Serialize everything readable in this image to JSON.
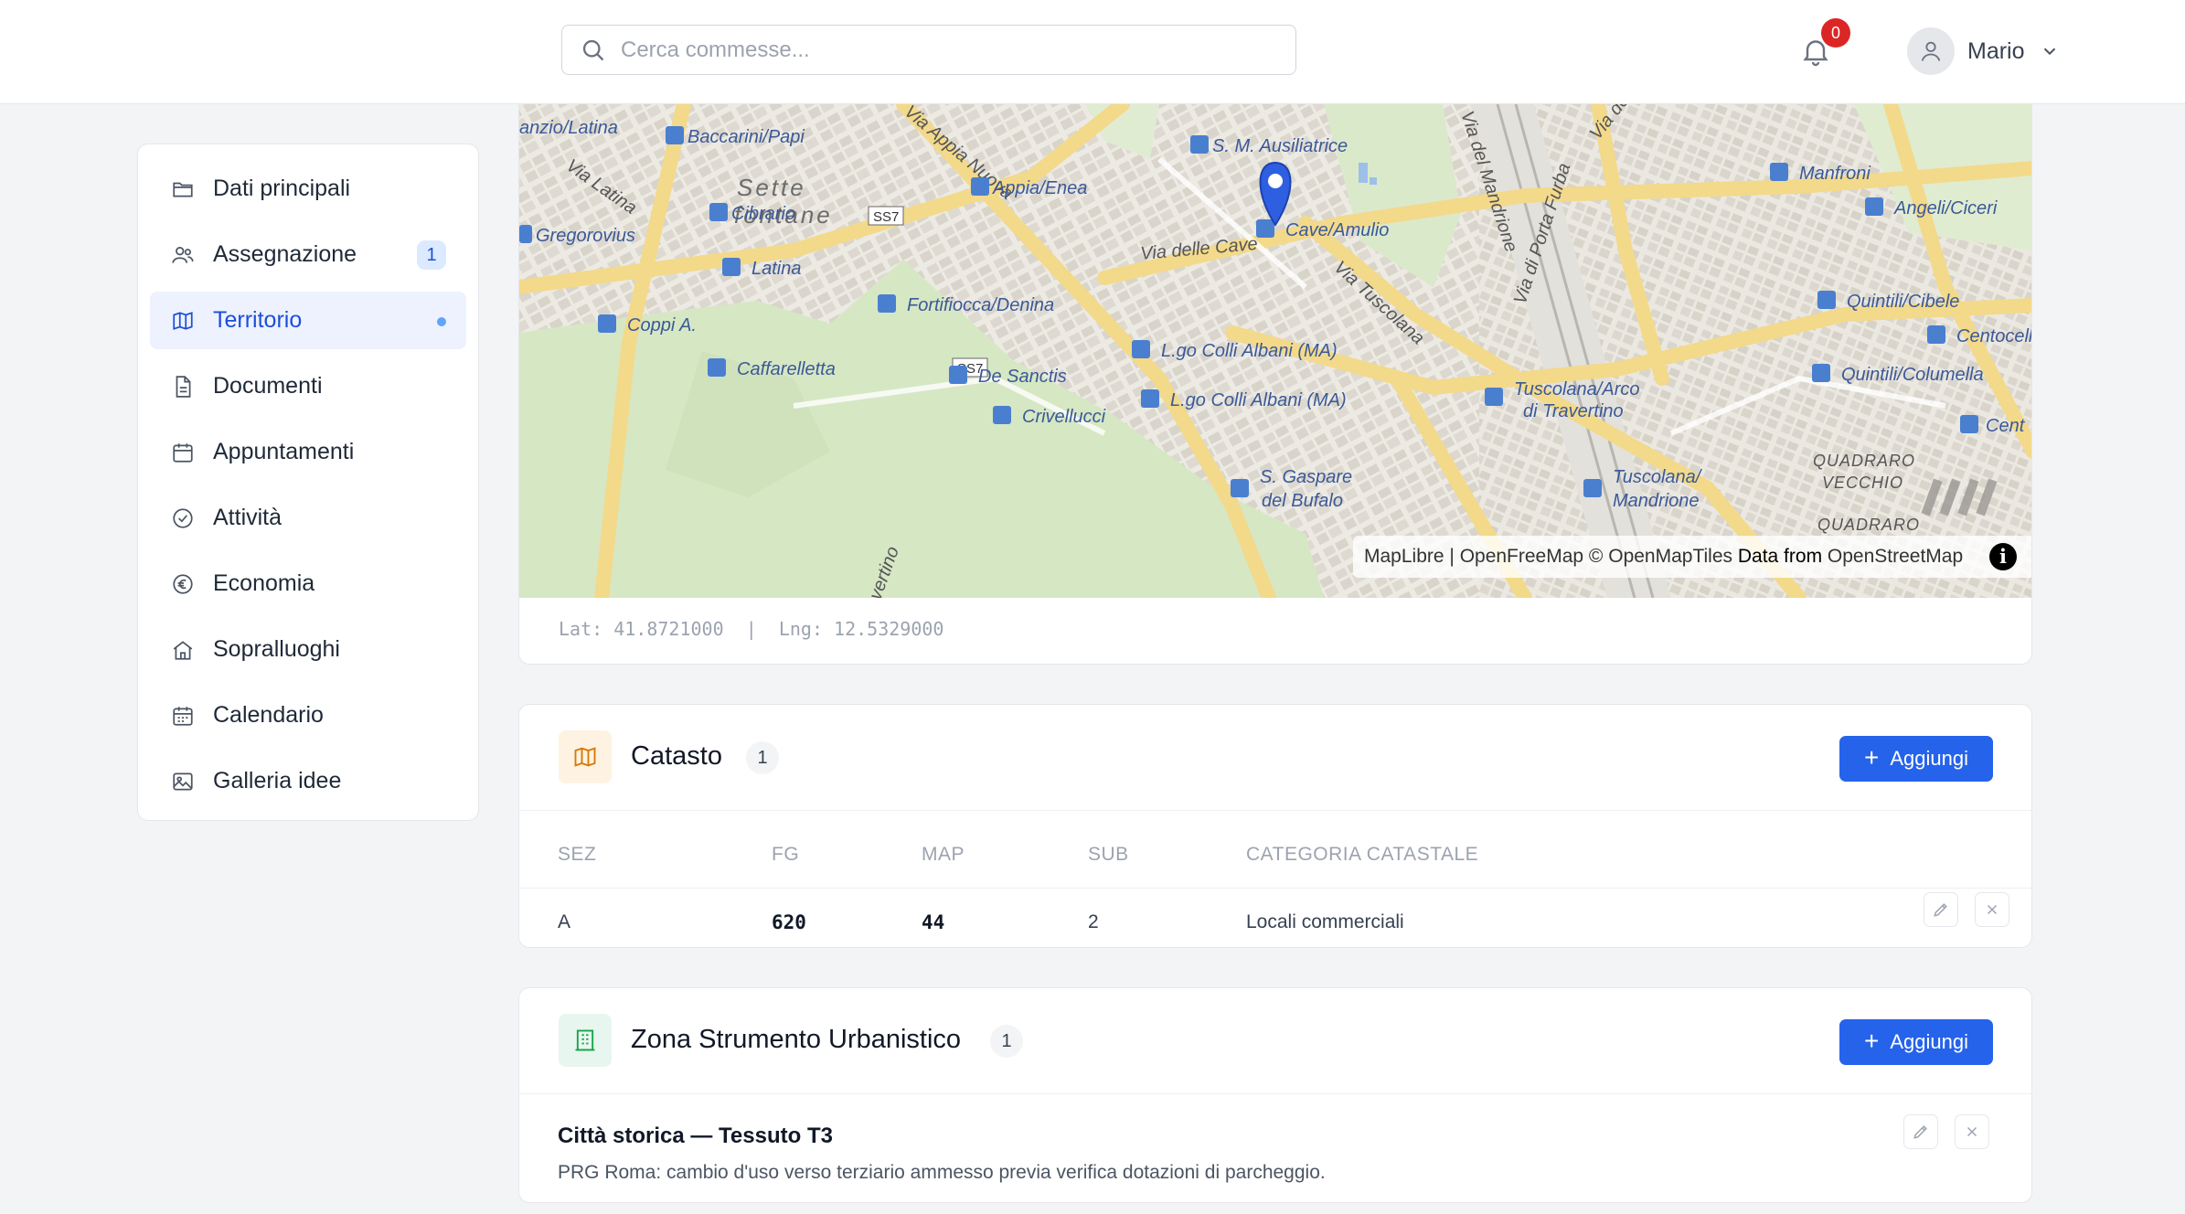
{
  "header": {
    "search_placeholder": "Cerca commesse...",
    "notification_count": "0",
    "user_name": "Mario"
  },
  "sidebar": {
    "items": [
      {
        "label": "Dati principali",
        "icon": "folder-icon"
      },
      {
        "label": "Assegnazione",
        "icon": "users-icon",
        "count": "1"
      },
      {
        "label": "Territorio",
        "icon": "map-icon",
        "active": true
      },
      {
        "label": "Documenti",
        "icon": "document-icon"
      },
      {
        "label": "Appuntamenti",
        "icon": "calendar-icon"
      },
      {
        "label": "Attività",
        "icon": "check-circle-icon"
      },
      {
        "label": "Economia",
        "icon": "euro-icon"
      },
      {
        "label": "Sopralluoghi",
        "icon": "home-icon"
      },
      {
        "label": "Calendario",
        "icon": "calendar-grid-icon"
      },
      {
        "label": "Galleria idee",
        "icon": "image-icon"
      }
    ]
  },
  "map": {
    "attribution_maplibre": "MapLibre",
    "attribution_sep": " | ",
    "attribution_ofm": "OpenFreeMap",
    "attribution_omt": " © OpenMapTiles",
    "attribution_data": " Data from ",
    "attribution_osm": "OpenStreetMap",
    "info_glyph": "i",
    "coords": "Lat: 41.8721000  |  Lng: 12.5329000",
    "streets": {
      "s1": "Via delle Cave",
      "s2": "Via Tuscolana",
      "s3": "Via di Porta Furba",
      "s4": "Via Latina",
      "s5": "Via del Mandrione",
      "s6": "Via degli Angeli",
      "s7": "Via Appia Nuova",
      "s8": "SS7",
      "s9": "SS7",
      "s10": "Travertino"
    },
    "areas": {
      "a1": "Sette",
      "a2": "fontane",
      "a3": "QUADRARO",
      "a4": "VECCHIO",
      "a5": "QUADRARO"
    },
    "stops": {
      "p1": "Baccarini/Papi",
      "p2": "S. M. Ausiliatrice",
      "p3": "Cibrario",
      "p4": "Appia/Enea",
      "p5": "Cave/Amulio",
      "p6": "Gregorovius",
      "p7": "Latina",
      "p8": "Fortifiocca/Denina",
      "p9": "Coppi A.",
      "p10": "Caffarelletta",
      "p11": "De Sanctis",
      "p12": "Crivellucci",
      "p13": "L.go Colli Albani (MA)",
      "p14": "L.go Colli Albani (MA)",
      "p15": "Tuscolana/Arco",
      "p16": "di Travertino",
      "p17": "S. Gaspare",
      "p18": "del Bufalo",
      "p19": "Tuscolana/",
      "p20": "Mandrione",
      "p21": "Manfroni",
      "p22": "Angeli/Ciceri",
      "p23": "Quintili/Cibele",
      "p24": "Centocell",
      "p25": "Quintili/Columella",
      "p26": "Cent",
      "p27": "anzio/Latina"
    }
  },
  "catasto": {
    "title": "Catasto",
    "count": "1",
    "add_label": "Aggiungi",
    "columns": {
      "sez": "SEZ",
      "fg": "FG",
      "map": "MAP",
      "sub": "SUB",
      "cat": "CATEGORIA CATASTALE"
    },
    "rows": [
      {
        "sez": "A",
        "fg": "620",
        "map": "44",
        "sub": "2",
        "cat": "Locali commerciali"
      }
    ]
  },
  "zona": {
    "title": "Zona Strumento Urbanistico",
    "count": "1",
    "add_label": "Aggiungi",
    "item_title": "Città storica — Tessuto T3",
    "item_desc": "PRG Roma: cambio d'uso verso terziario ammesso previa verifica dotazioni di parcheggio."
  },
  "colors": {
    "primary": "#2563eb",
    "active_bg": "#eef2ff",
    "badge_red": "#dc2626",
    "map_marker": "#2d5fe0"
  }
}
